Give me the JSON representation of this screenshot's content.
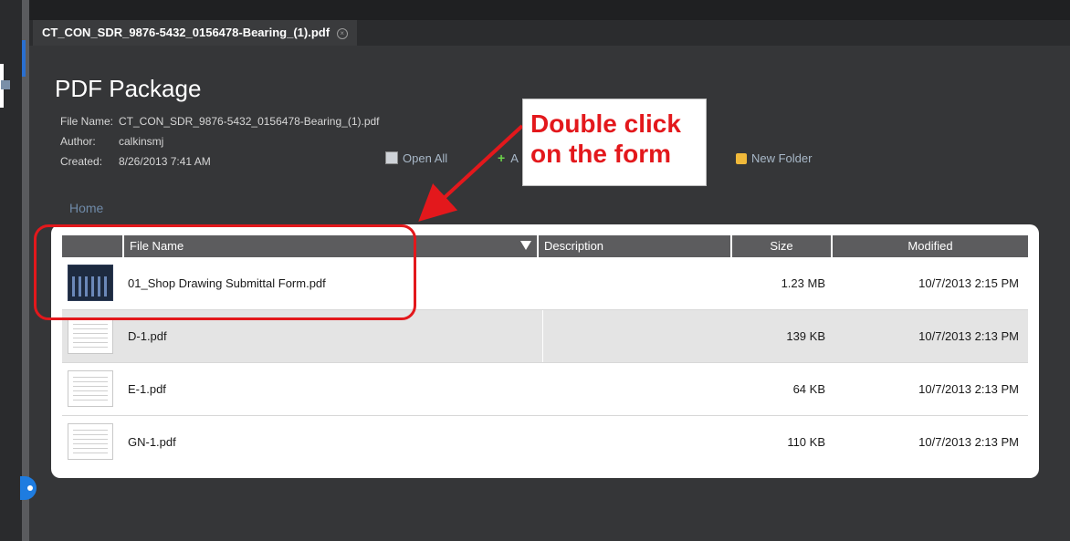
{
  "tab": {
    "title": "CT_CON_SDR_9876-5432_0156478-Bearing_(1).pdf"
  },
  "package": {
    "title": "PDF Package",
    "meta": [
      {
        "label": "File Name:",
        "value": "CT_CON_SDR_9876-5432_0156478-Bearing_(1).pdf"
      },
      {
        "label": "Author:",
        "value": "calkinsmj"
      },
      {
        "label": "Created:",
        "value": "8/26/2013 7:41 AM"
      }
    ]
  },
  "toolbar": {
    "open_all": "Open All",
    "add_partial": "A",
    "new_folder": "New Folder"
  },
  "breadcrumb": {
    "home": "Home"
  },
  "table": {
    "headers": {
      "file_name": "File Name",
      "description": "Description",
      "size": "Size",
      "modified": "Modified"
    },
    "rows": [
      {
        "name": "01_Shop Drawing Submittal Form.pdf",
        "description": "",
        "size": "1.23 MB",
        "modified": "10/7/2013 2:15 PM",
        "thumb": "form-thumbnail-icon"
      },
      {
        "name": "D-1.pdf",
        "description": "",
        "size": "139 KB",
        "modified": "10/7/2013 2:13 PM",
        "thumb": "drawing-thumbnail-icon"
      },
      {
        "name": "E-1.pdf",
        "description": "",
        "size": "64 KB",
        "modified": "10/7/2013 2:13 PM",
        "thumb": "drawing-thumbnail-icon"
      },
      {
        "name": "GN-1.pdf",
        "description": "",
        "size": "110 KB",
        "modified": "10/7/2013 2:13 PM",
        "thumb": "drawing-thumbnail-icon"
      }
    ]
  },
  "annotation": {
    "line1": "Double click",
    "line2": "on the form",
    "color": "#e3181c"
  }
}
